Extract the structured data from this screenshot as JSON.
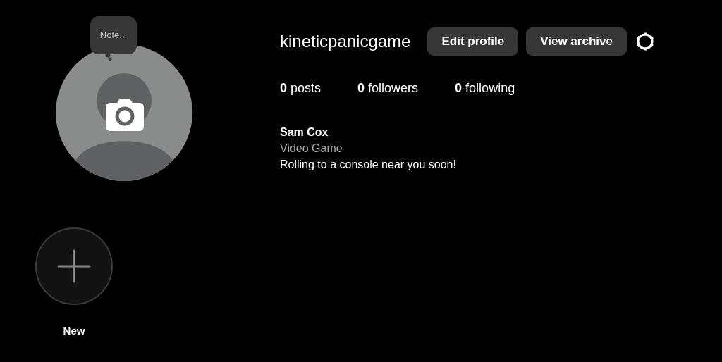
{
  "note_prompt": "Note...",
  "profile": {
    "username": "kineticpanicgame"
  },
  "buttons": [
    {
      "label": "Edit profile"
    },
    {
      "label": "View archive"
    }
  ],
  "stats": [
    "**0** posts",
    "**0** followers",
    "**0** following"
  ],
  "bio": {
    "name": "Sam Cox",
    "category": "Video Game",
    "text": "Rolling to a console near you soon!"
  },
  "highlights": [
    {
      "label": "New",
      "kind": "new"
    }
  ]
}
